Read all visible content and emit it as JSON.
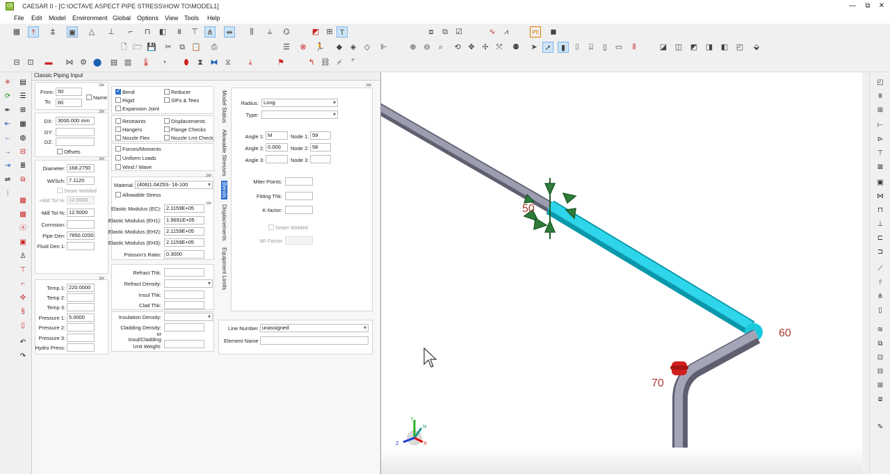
{
  "window": {
    "title": "CAESAR II - [C:\\OCTAVE ASPECT PIPE STRESS\\HOW TO\\MODEL1]",
    "logo_text": "CII",
    "controls": [
      "—",
      "⧉",
      "✕"
    ]
  },
  "menu": [
    "File",
    "Edit",
    "Model",
    "Environment",
    "Global",
    "Options",
    "View",
    "Tools",
    "Help"
  ],
  "panel": {
    "title": "Classic Piping Input",
    "expand": ">>",
    "nodes": {
      "from_label": "From:",
      "from_value": "50",
      "to_label": "To:",
      "to_value": "60",
      "name_label": "Name"
    },
    "deltas": {
      "dx_label": "DX:",
      "dx_value": "3000.000 mm",
      "dy_label": "DY:",
      "dy_value": "",
      "dz_label": "DZ:",
      "dz_value": "",
      "offsets_label": "Offsets"
    },
    "pipe": {
      "diameter_label": "Diameter:",
      "diameter_value": "168.2750",
      "wtsch_label": "Wt/Sch:",
      "wtsch_value": "7.1120",
      "seam_label": "Seam Welded",
      "plus_mill_label": "+Mill Tol %:",
      "plus_mill_value": "12.5000",
      "minus_mill_label": "-Mill Tol %:",
      "minus_mill_value": "12.5000",
      "corrosion_label": "Corrosion:",
      "corrosion_value": "",
      "pipe_den_label": "Pipe Den:",
      "pipe_den_value": "7850.02002",
      "fluid_den_label": "Fluid Den 1:",
      "fluid_den_value": ""
    },
    "operating": {
      "temp1_label": "Temp 1:",
      "temp1_value": "220.0000",
      "temp2_label": "Temp 2:",
      "temp3_label": "Temp 3:",
      "p1_label": "Pressure 1:",
      "p1_value": "5.0000",
      "p2_label": "Pressure 2:",
      "p3_label": "Pressure 3:",
      "hydro_label": "Hydro Press:"
    },
    "elements": {
      "bend": "Bend",
      "reducer": "Reducer",
      "rigid": "Rigid",
      "sifs": "SIFs & Tees",
      "expansion": "Expansion Joint",
      "restraints": "Restraints",
      "displacements": "Displacements",
      "hangers": "Hangers",
      "flange": "Flange Checks",
      "nozzle_flex": "Nozzle Flex",
      "nozzle_lmt": "Nozzle Lmt Check",
      "forces": "Forces/Moments",
      "uniform": "Uniform Loads",
      "wind": "Wind / Wave"
    },
    "material": {
      "material_label": "Material:",
      "material_value": "(408)1.0425S- 16-100",
      "allowable_label": "Allowable Stress",
      "ec_label": "Elastic Modulus (EC):",
      "ec_value": "2.1159E+05",
      "eh1_label": "Elastic Modulus (EH1):",
      "eh1_value": "1.9691E+05",
      "eh2_label": "Elastic Modulus (EH2):",
      "eh2_value": "2.1159E+05",
      "eh3_label": "Elastic Modulus (EH3):",
      "eh3_value": "2.1159E+05",
      "poisson_label": "Poisson's Ratio:",
      "poisson_value": "0.3000"
    },
    "refractory": {
      "thk_label": "Refract Thk:",
      "den_label": "Refract Density:",
      "insul_label": "Insul Thk:",
      "clad_label": "Clad Thk:",
      "insul_den_label": "Insulation Density:",
      "clad_den_label": "Cladding Density:",
      "or_label": "or",
      "unit_wt_label1": "Insul/Cladding",
      "unit_wt_label2": "Unit Weight:"
    },
    "tabs": [
      "Model Status",
      "Allowable Stresses",
      "Bends",
      "Displacements",
      "Equipment Limits"
    ],
    "bend": {
      "radius_label": "Radius:",
      "radius_value": "Long",
      "type_label": "Type:",
      "type_value": "",
      "angle1_label": "Angle 1:",
      "angle1_value": "M",
      "node1_label": "Node 1:",
      "node1_value": "59",
      "angle2_label": "Angle 2:",
      "angle2_value": "0.000",
      "node2_label": "Node 2:",
      "node2_value": "58",
      "angle3_label": "Angle 3:",
      "angle3_value": "",
      "node3_label": "Node 3:",
      "node3_value": "",
      "miter_label": "Miter Points:",
      "fitting_label": "Fitting Thk:",
      "kfactor_label": "K-factor:",
      "seam_label": "Seam Welded",
      "wl_label": "W/ Factor"
    },
    "line": {
      "line_number_label": "Line Number :",
      "line_number_value": "unassigned",
      "element_name_label": "Element Name :",
      "element_name_value": ""
    }
  },
  "viewport": {
    "node_labels": [
      "50",
      "60",
      "70"
    ],
    "triad": {
      "y": "Y",
      "n": "N",
      "x": "X",
      "z": "Z"
    },
    "colors": {
      "pipe": "#8f8fa3",
      "selected": "#19c9de",
      "restraint": "#2e7d3a",
      "flange": "#d11f1f",
      "node_text": "#a83a2e"
    }
  }
}
